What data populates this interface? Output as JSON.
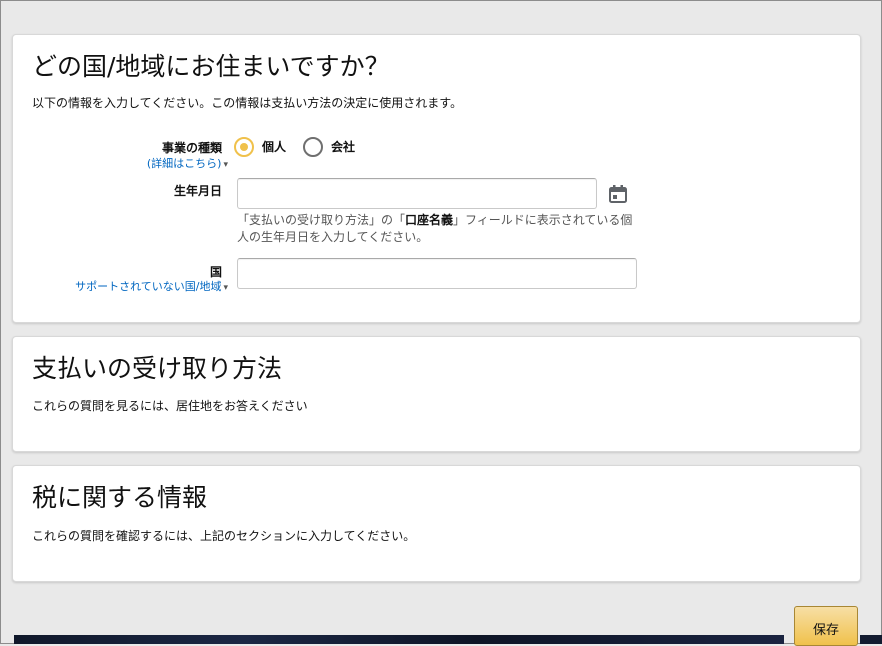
{
  "residence": {
    "title": "どの国/地域にお住まいですか？",
    "subtitle": "以下の情報を入力してください。この情報は支払い方法の決定に使用されます。",
    "business_type": {
      "label": "事業の種類",
      "help_link": "(詳細はこちら)",
      "options": [
        {
          "label": "個人",
          "selected": true
        },
        {
          "label": "会社",
          "selected": false
        }
      ]
    },
    "birth_date": {
      "label": "生年月日",
      "value": "",
      "placeholder": "",
      "hint_prefix": "「支払いの受け取り方法」の「",
      "hint_bold": "口座名義",
      "hint_suffix": "」フィールドに表示されている個人の生年月日を入力してください。",
      "icon": "calendar-icon"
    },
    "country": {
      "label": "国",
      "help_link": "サポートされていない国/地域",
      "value": ""
    }
  },
  "payment": {
    "title": "支払いの受け取り方法",
    "subtitle": "これらの質問を見るには、居住地をお答えください"
  },
  "tax": {
    "title": "税に関する情報",
    "subtitle": "これらの質問を確認するには、上記のセクションに入力してください。"
  },
  "actions": {
    "save_label": "保存"
  },
  "colors": {
    "accent": "#f0c14b",
    "link": "#0066c0",
    "background": "#e9e9e9"
  }
}
